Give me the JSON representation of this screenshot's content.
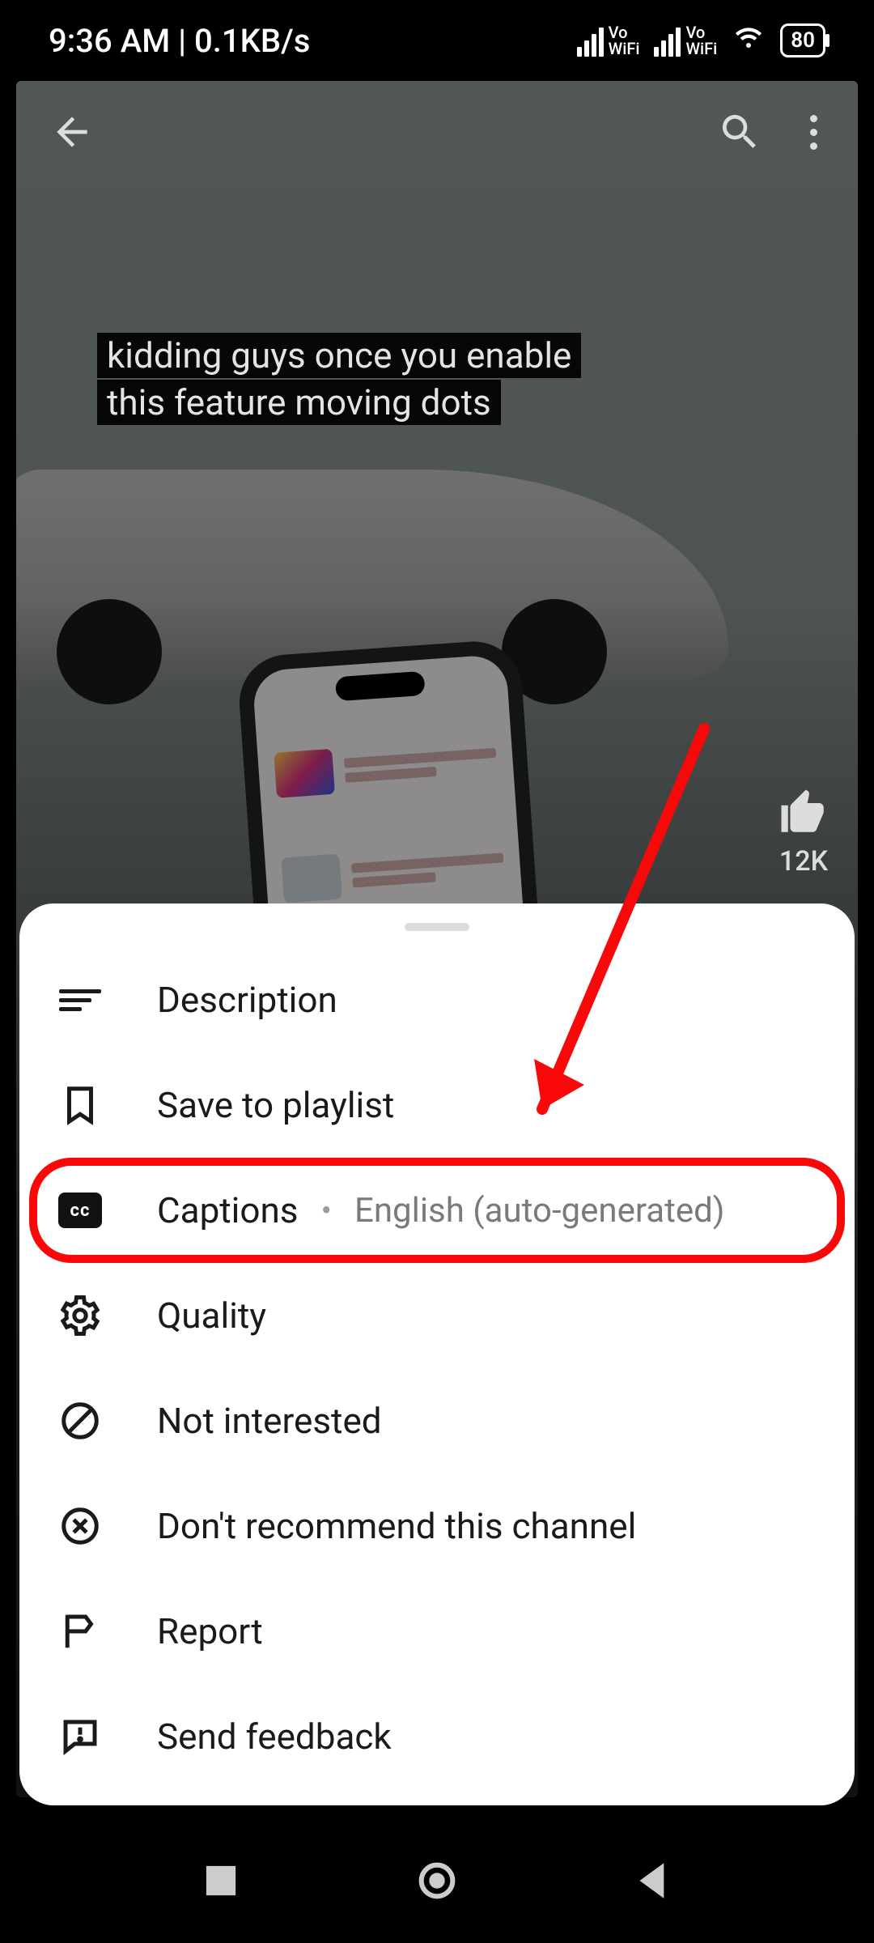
{
  "status": {
    "time": "9:36 AM",
    "net_speed": "0.1KB/s",
    "vo_label": "Vo",
    "wifi_label": "WiFi",
    "battery_pct": "80"
  },
  "video": {
    "caption_text": "kidding guys once you enable this feature moving dots",
    "like_count": "12K"
  },
  "sheet": {
    "items": [
      {
        "id": "description",
        "label": "Description"
      },
      {
        "id": "save_playlist",
        "label": "Save to playlist"
      },
      {
        "id": "captions",
        "label": "Captions",
        "sub": "English (auto-generated)"
      },
      {
        "id": "quality",
        "label": "Quality"
      },
      {
        "id": "not_interested",
        "label": "Not interested"
      },
      {
        "id": "dont_recommend",
        "label": "Don't recommend this channel"
      },
      {
        "id": "report",
        "label": "Report"
      },
      {
        "id": "send_feedback",
        "label": "Send feedback"
      }
    ],
    "cc_badge": "cc"
  },
  "annotation": {
    "arrow_color": "#f80808"
  }
}
